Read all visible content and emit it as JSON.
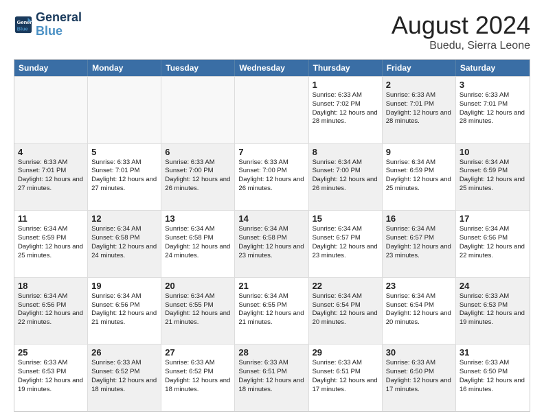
{
  "logo": {
    "line1": "General",
    "line2": "Blue"
  },
  "title": "August 2024",
  "subtitle": "Buedu, Sierra Leone",
  "days": [
    "Sunday",
    "Monday",
    "Tuesday",
    "Wednesday",
    "Thursday",
    "Friday",
    "Saturday"
  ],
  "rows": [
    [
      {
        "day": "",
        "sunrise": "",
        "sunset": "",
        "daylight": "",
        "shaded": false,
        "empty": true
      },
      {
        "day": "",
        "sunrise": "",
        "sunset": "",
        "daylight": "",
        "shaded": false,
        "empty": true
      },
      {
        "day": "",
        "sunrise": "",
        "sunset": "",
        "daylight": "",
        "shaded": false,
        "empty": true
      },
      {
        "day": "",
        "sunrise": "",
        "sunset": "",
        "daylight": "",
        "shaded": false,
        "empty": true
      },
      {
        "day": "1",
        "sunrise": "Sunrise: 6:33 AM",
        "sunset": "Sunset: 7:02 PM",
        "daylight": "Daylight: 12 hours and 28 minutes.",
        "shaded": false,
        "empty": false
      },
      {
        "day": "2",
        "sunrise": "Sunrise: 6:33 AM",
        "sunset": "Sunset: 7:01 PM",
        "daylight": "Daylight: 12 hours and 28 minutes.",
        "shaded": true,
        "empty": false
      },
      {
        "day": "3",
        "sunrise": "Sunrise: 6:33 AM",
        "sunset": "Sunset: 7:01 PM",
        "daylight": "Daylight: 12 hours and 28 minutes.",
        "shaded": false,
        "empty": false
      }
    ],
    [
      {
        "day": "4",
        "sunrise": "Sunrise: 6:33 AM",
        "sunset": "Sunset: 7:01 PM",
        "daylight": "Daylight: 12 hours and 27 minutes.",
        "shaded": true,
        "empty": false
      },
      {
        "day": "5",
        "sunrise": "Sunrise: 6:33 AM",
        "sunset": "Sunset: 7:01 PM",
        "daylight": "Daylight: 12 hours and 27 minutes.",
        "shaded": false,
        "empty": false
      },
      {
        "day": "6",
        "sunrise": "Sunrise: 6:33 AM",
        "sunset": "Sunset: 7:00 PM",
        "daylight": "Daylight: 12 hours and 26 minutes.",
        "shaded": true,
        "empty": false
      },
      {
        "day": "7",
        "sunrise": "Sunrise: 6:33 AM",
        "sunset": "Sunset: 7:00 PM",
        "daylight": "Daylight: 12 hours and 26 minutes.",
        "shaded": false,
        "empty": false
      },
      {
        "day": "8",
        "sunrise": "Sunrise: 6:34 AM",
        "sunset": "Sunset: 7:00 PM",
        "daylight": "Daylight: 12 hours and 26 minutes.",
        "shaded": true,
        "empty": false
      },
      {
        "day": "9",
        "sunrise": "Sunrise: 6:34 AM",
        "sunset": "Sunset: 6:59 PM",
        "daylight": "Daylight: 12 hours and 25 minutes.",
        "shaded": false,
        "empty": false
      },
      {
        "day": "10",
        "sunrise": "Sunrise: 6:34 AM",
        "sunset": "Sunset: 6:59 PM",
        "daylight": "Daylight: 12 hours and 25 minutes.",
        "shaded": true,
        "empty": false
      }
    ],
    [
      {
        "day": "11",
        "sunrise": "Sunrise: 6:34 AM",
        "sunset": "Sunset: 6:59 PM",
        "daylight": "Daylight: 12 hours and 25 minutes.",
        "shaded": false,
        "empty": false
      },
      {
        "day": "12",
        "sunrise": "Sunrise: 6:34 AM",
        "sunset": "Sunset: 6:58 PM",
        "daylight": "Daylight: 12 hours and 24 minutes.",
        "shaded": true,
        "empty": false
      },
      {
        "day": "13",
        "sunrise": "Sunrise: 6:34 AM",
        "sunset": "Sunset: 6:58 PM",
        "daylight": "Daylight: 12 hours and 24 minutes.",
        "shaded": false,
        "empty": false
      },
      {
        "day": "14",
        "sunrise": "Sunrise: 6:34 AM",
        "sunset": "Sunset: 6:58 PM",
        "daylight": "Daylight: 12 hours and 23 minutes.",
        "shaded": true,
        "empty": false
      },
      {
        "day": "15",
        "sunrise": "Sunrise: 6:34 AM",
        "sunset": "Sunset: 6:57 PM",
        "daylight": "Daylight: 12 hours and 23 minutes.",
        "shaded": false,
        "empty": false
      },
      {
        "day": "16",
        "sunrise": "Sunrise: 6:34 AM",
        "sunset": "Sunset: 6:57 PM",
        "daylight": "Daylight: 12 hours and 23 minutes.",
        "shaded": true,
        "empty": false
      },
      {
        "day": "17",
        "sunrise": "Sunrise: 6:34 AM",
        "sunset": "Sunset: 6:56 PM",
        "daylight": "Daylight: 12 hours and 22 minutes.",
        "shaded": false,
        "empty": false
      }
    ],
    [
      {
        "day": "18",
        "sunrise": "Sunrise: 6:34 AM",
        "sunset": "Sunset: 6:56 PM",
        "daylight": "Daylight: 12 hours and 22 minutes.",
        "shaded": true,
        "empty": false
      },
      {
        "day": "19",
        "sunrise": "Sunrise: 6:34 AM",
        "sunset": "Sunset: 6:56 PM",
        "daylight": "Daylight: 12 hours and 21 minutes.",
        "shaded": false,
        "empty": false
      },
      {
        "day": "20",
        "sunrise": "Sunrise: 6:34 AM",
        "sunset": "Sunset: 6:55 PM",
        "daylight": "Daylight: 12 hours and 21 minutes.",
        "shaded": true,
        "empty": false
      },
      {
        "day": "21",
        "sunrise": "Sunrise: 6:34 AM",
        "sunset": "Sunset: 6:55 PM",
        "daylight": "Daylight: 12 hours and 21 minutes.",
        "shaded": false,
        "empty": false
      },
      {
        "day": "22",
        "sunrise": "Sunrise: 6:34 AM",
        "sunset": "Sunset: 6:54 PM",
        "daylight": "Daylight: 12 hours and 20 minutes.",
        "shaded": true,
        "empty": false
      },
      {
        "day": "23",
        "sunrise": "Sunrise: 6:34 AM",
        "sunset": "Sunset: 6:54 PM",
        "daylight": "Daylight: 12 hours and 20 minutes.",
        "shaded": false,
        "empty": false
      },
      {
        "day": "24",
        "sunrise": "Sunrise: 6:33 AM",
        "sunset": "Sunset: 6:53 PM",
        "daylight": "Daylight: 12 hours and 19 minutes.",
        "shaded": true,
        "empty": false
      }
    ],
    [
      {
        "day": "25",
        "sunrise": "Sunrise: 6:33 AM",
        "sunset": "Sunset: 6:53 PM",
        "daylight": "Daylight: 12 hours and 19 minutes.",
        "shaded": false,
        "empty": false
      },
      {
        "day": "26",
        "sunrise": "Sunrise: 6:33 AM",
        "sunset": "Sunset: 6:52 PM",
        "daylight": "Daylight: 12 hours and 18 minutes.",
        "shaded": true,
        "empty": false
      },
      {
        "day": "27",
        "sunrise": "Sunrise: 6:33 AM",
        "sunset": "Sunset: 6:52 PM",
        "daylight": "Daylight: 12 hours and 18 minutes.",
        "shaded": false,
        "empty": false
      },
      {
        "day": "28",
        "sunrise": "Sunrise: 6:33 AM",
        "sunset": "Sunset: 6:51 PM",
        "daylight": "Daylight: 12 hours and 18 minutes.",
        "shaded": true,
        "empty": false
      },
      {
        "day": "29",
        "sunrise": "Sunrise: 6:33 AM",
        "sunset": "Sunset: 6:51 PM",
        "daylight": "Daylight: 12 hours and 17 minutes.",
        "shaded": false,
        "empty": false
      },
      {
        "day": "30",
        "sunrise": "Sunrise: 6:33 AM",
        "sunset": "Sunset: 6:50 PM",
        "daylight": "Daylight: 12 hours and 17 minutes.",
        "shaded": true,
        "empty": false
      },
      {
        "day": "31",
        "sunrise": "Sunrise: 6:33 AM",
        "sunset": "Sunset: 6:50 PM",
        "daylight": "Daylight: 12 hours and 16 minutes.",
        "shaded": false,
        "empty": false
      }
    ]
  ]
}
